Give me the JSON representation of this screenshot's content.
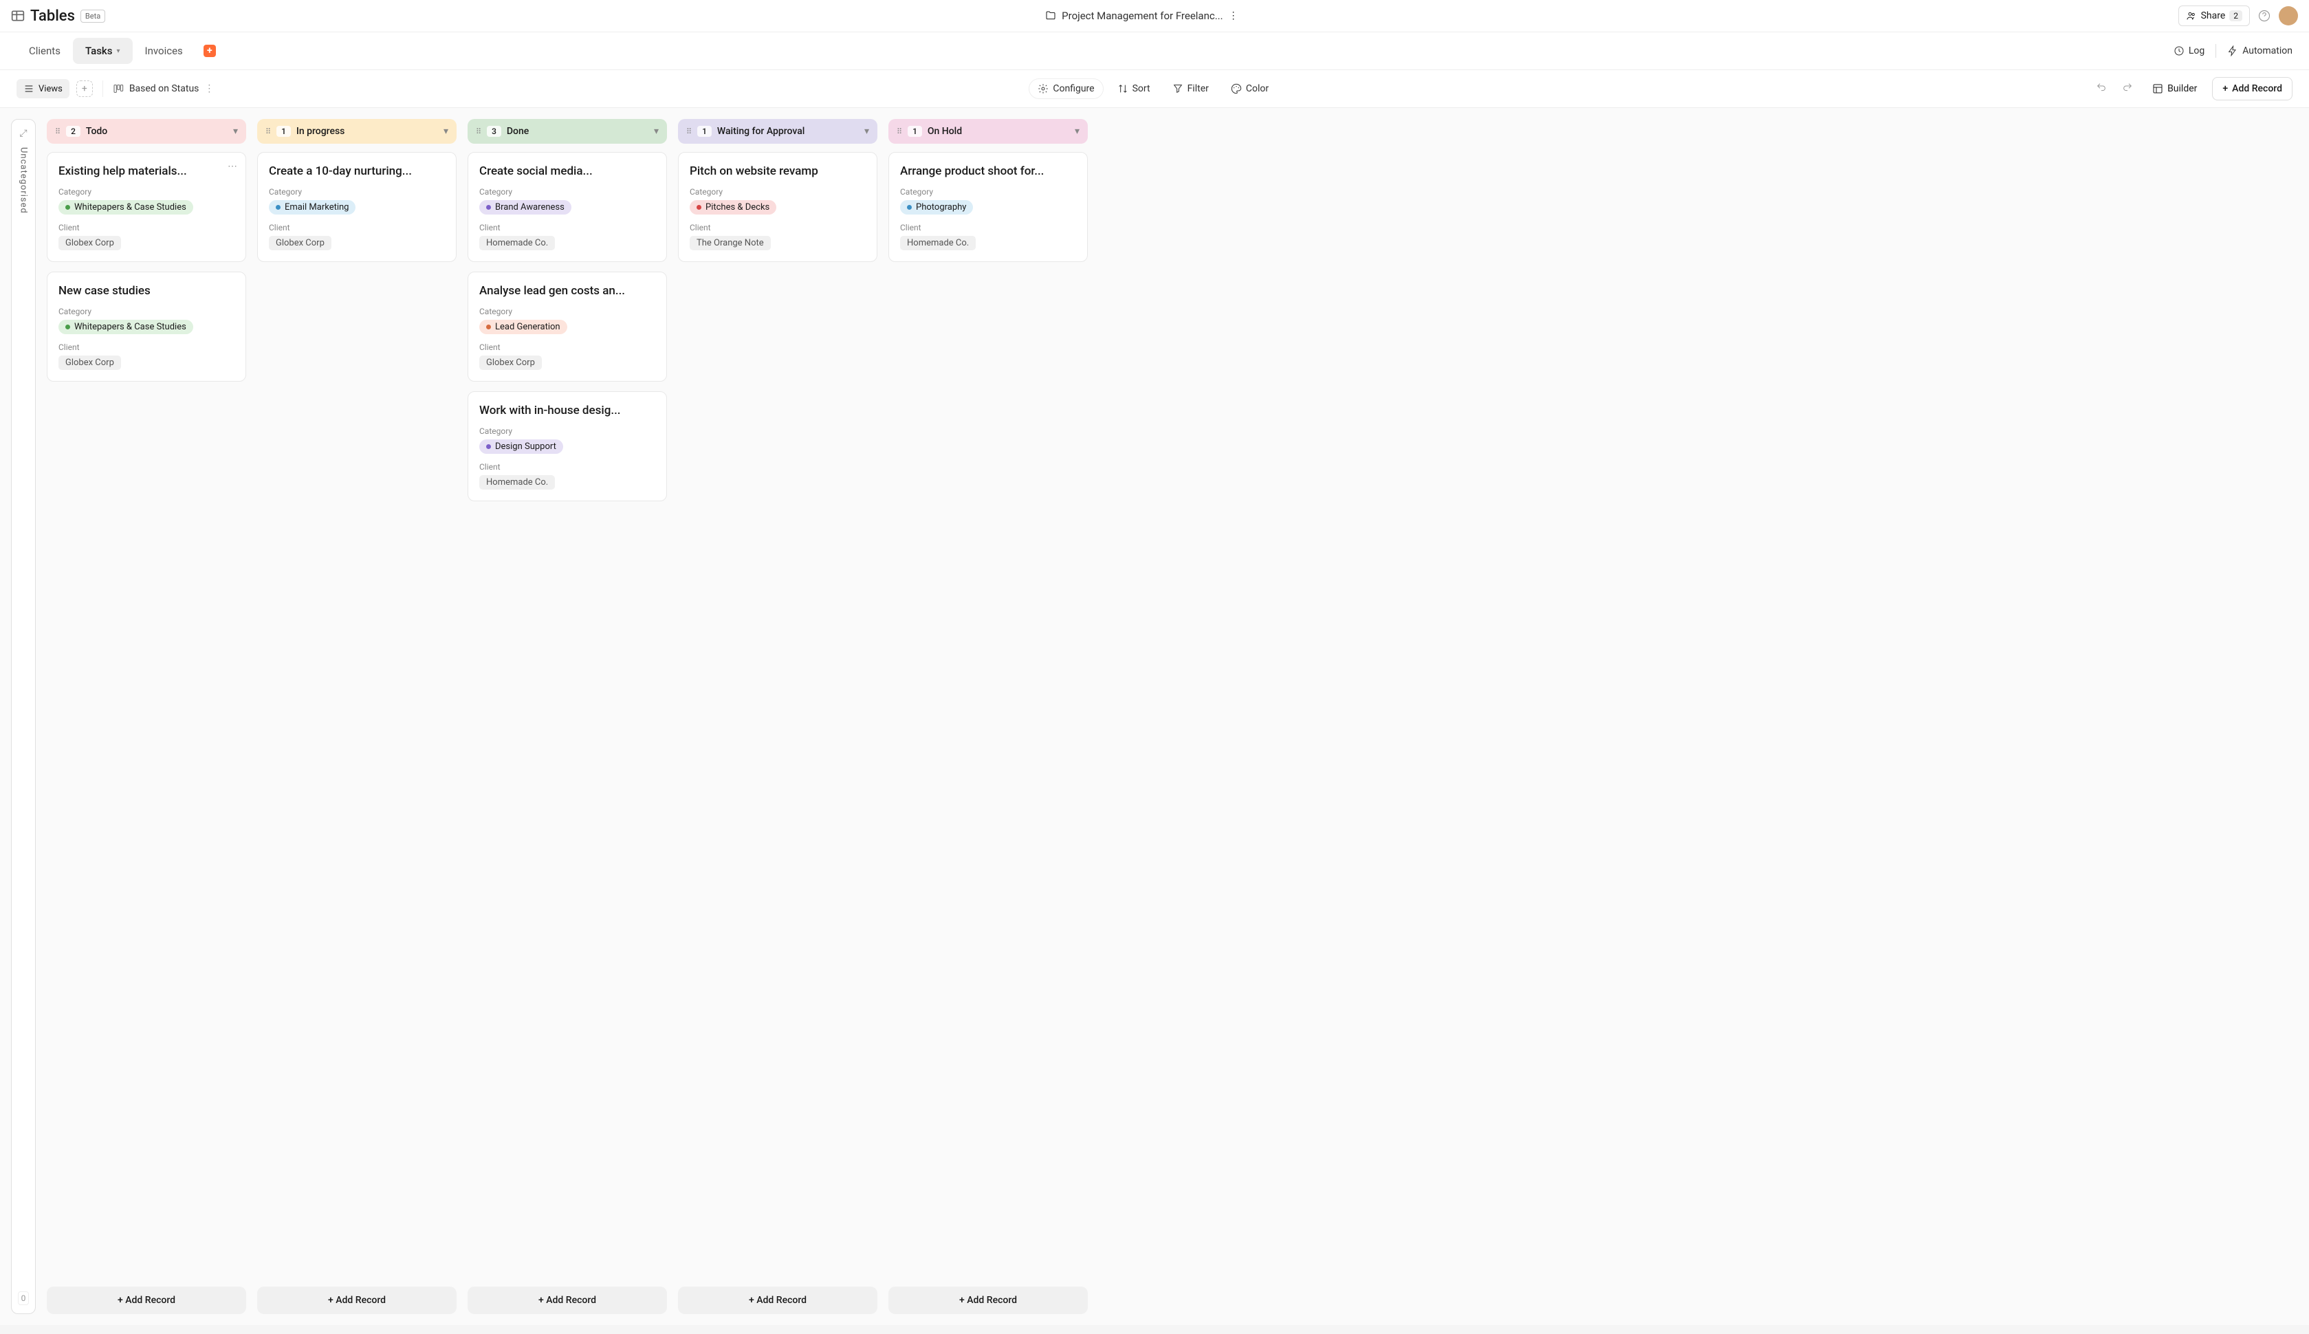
{
  "header": {
    "app_title": "Tables",
    "beta_label": "Beta",
    "project_name": "Project Management for Freelanc...",
    "share_label": "Share",
    "share_count": "2"
  },
  "tabs": {
    "items": [
      {
        "label": "Clients",
        "active": false
      },
      {
        "label": "Tasks",
        "active": true
      },
      {
        "label": "Invoices",
        "active": false
      }
    ],
    "log_label": "Log",
    "automation_label": "Automation"
  },
  "toolbar": {
    "views_label": "Views",
    "based_on_label": "Based on Status",
    "configure_label": "Configure",
    "sort_label": "Sort",
    "filter_label": "Filter",
    "color_label": "Color",
    "builder_label": "Builder",
    "add_record_label": "Add Record"
  },
  "uncategorised": {
    "label": "Uncategorised",
    "count": "0"
  },
  "columns": [
    {
      "id": "todo",
      "title": "Todo",
      "count": "2",
      "class": "todo",
      "cards": [
        {
          "title": "Existing help materials...",
          "category_label": "Category",
          "category": "Whitepapers & Case Studies",
          "category_class": "cat-whitepapers",
          "client_label": "Client",
          "client": "Globex Corp",
          "hover": true
        },
        {
          "title": "New case studies",
          "category_label": "Category",
          "category": "Whitepapers & Case Studies",
          "category_class": "cat-whitepapers",
          "client_label": "Client",
          "client": "Globex Corp"
        }
      ]
    },
    {
      "id": "in-progress",
      "title": "In progress",
      "count": "1",
      "class": "in-progress",
      "cards": [
        {
          "title": "Create a 10-day nurturing...",
          "category_label": "Category",
          "category": "Email Marketing",
          "category_class": "cat-email",
          "client_label": "Client",
          "client": "Globex Corp"
        }
      ]
    },
    {
      "id": "done",
      "title": "Done",
      "count": "3",
      "class": "done",
      "cards": [
        {
          "title": "Create social media...",
          "category_label": "Category",
          "category": "Brand Awareness",
          "category_class": "cat-brand",
          "client_label": "Client",
          "client": "Homemade Co."
        },
        {
          "title": "Analyse lead gen costs an...",
          "category_label": "Category",
          "category": "Lead Generation",
          "category_class": "cat-lead",
          "client_label": "Client",
          "client": "Globex Corp"
        },
        {
          "title": "Work with in-house desig...",
          "category_label": "Category",
          "category": "Design Support",
          "category_class": "cat-design",
          "client_label": "Client",
          "client": "Homemade Co."
        }
      ]
    },
    {
      "id": "waiting",
      "title": "Waiting for Approval",
      "count": "1",
      "class": "waiting",
      "cards": [
        {
          "title": "Pitch on website revamp",
          "category_label": "Category",
          "category": "Pitches & Decks",
          "category_class": "cat-pitches",
          "client_label": "Client",
          "client": "The Orange Note"
        }
      ]
    },
    {
      "id": "on-hold",
      "title": "On Hold",
      "count": "1",
      "class": "on-hold",
      "cards": [
        {
          "title": "Arrange product shoot for...",
          "category_label": "Category",
          "category": "Photography",
          "category_class": "cat-photo",
          "client_label": "Client",
          "client": "Homemade Co."
        }
      ]
    }
  ],
  "add_record_col_label": "Add Record"
}
